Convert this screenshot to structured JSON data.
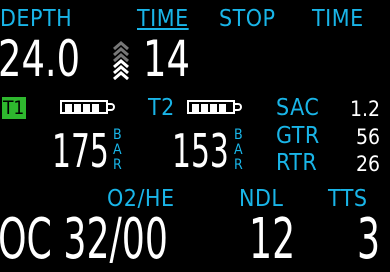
{
  "header": {
    "depth": "DEPTH",
    "time": "TIME",
    "stop": "STOP",
    "stop_time": "TIME"
  },
  "current": {
    "depth": "24.0",
    "time": "14"
  },
  "tanks": {
    "t1": {
      "label": "T1",
      "pressure": "175",
      "unit_b": "B",
      "unit_a": "A",
      "unit_r": "R"
    },
    "t2": {
      "label": "T2",
      "pressure": "153",
      "unit_b": "B",
      "unit_a": "A",
      "unit_r": "R"
    }
  },
  "stats": {
    "sac_label": "SAC",
    "sac": "1.2",
    "gtr_label": "GTR",
    "gtr": "56",
    "rtr_label": "RTR",
    "rtr": "26"
  },
  "bottom": {
    "gas_label": "O2/HE",
    "ndl_label": "NDL",
    "tts_label": "TTS",
    "gas": "OC 32/00",
    "ndl": "12",
    "tts": "3"
  },
  "colors": {
    "accent": "#19b5e8",
    "active_tank": "#2eb82e",
    "text": "#ffffff",
    "background": "#000000"
  }
}
